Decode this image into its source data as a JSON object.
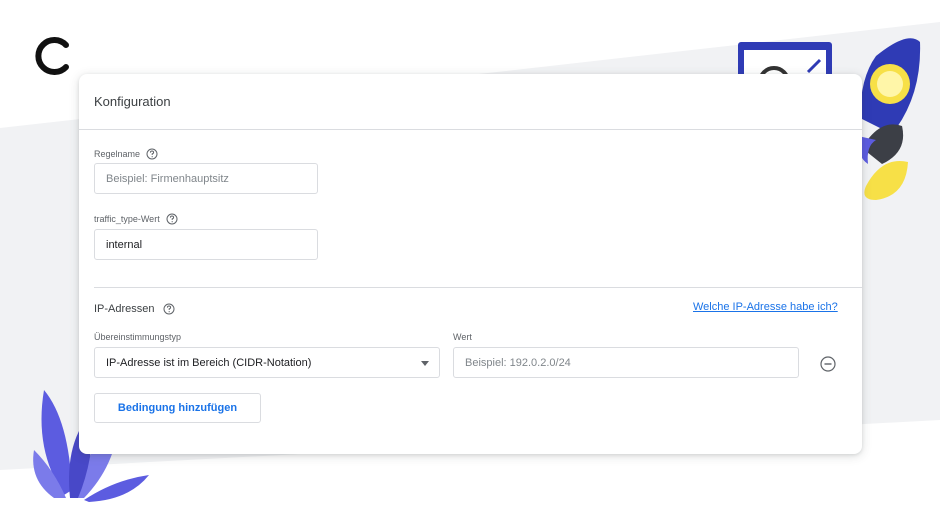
{
  "card": {
    "title": "Konfiguration"
  },
  "rule_name": {
    "label": "Regelname",
    "placeholder": "Beispiel: Firmenhauptsitz",
    "value": ""
  },
  "traffic_type": {
    "label": "traffic_type-Wert",
    "value": "internal"
  },
  "ip_section": {
    "title": "IP-Adressen",
    "help_link": "Welche IP-Adresse habe ich?",
    "match_type_label": "Übereinstimmungstyp",
    "match_type_value": "IP-Adresse ist im Bereich (CIDR-Notation)",
    "value_label": "Wert",
    "value_placeholder": "Beispiel: 192.0.2.0/24",
    "add_condition_label": "Bedingung hinzufügen"
  },
  "icons": {
    "logo": "c-logo-icon",
    "help": "help-circle-icon",
    "dropdown": "chevron-down-icon",
    "remove": "remove-circle-icon"
  },
  "colors": {
    "link": "#1a73e8",
    "border": "#dadce0",
    "accent_purple": "#5c5ce0",
    "accent_yellow": "#f7e047"
  }
}
